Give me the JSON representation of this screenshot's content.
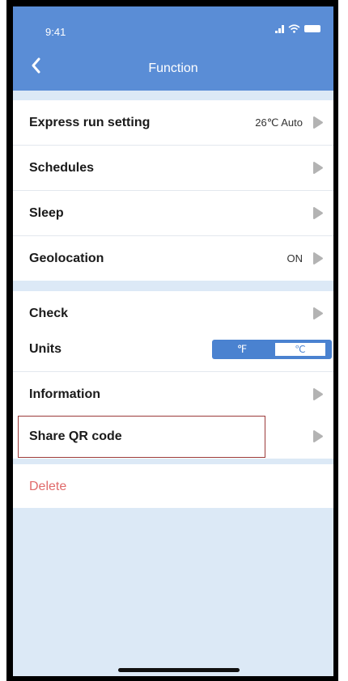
{
  "status_bar": {
    "time": "9:41",
    "signal_icon": "signal-icon",
    "wifi_icon": "wifi-icon",
    "battery_icon": "battery-icon"
  },
  "header": {
    "title": "Function",
    "back_icon": "chevron-left-icon",
    "background_color": "#5a8dd6"
  },
  "settings": {
    "express_run": {
      "label": "Express run setting",
      "value": "26℃ Auto"
    },
    "schedules": {
      "label": "Schedules"
    },
    "sleep": {
      "label": "Sleep"
    },
    "geolocation": {
      "label": "Geolocation",
      "value": "ON"
    },
    "check": {
      "label": "Check"
    },
    "units": {
      "label": "Units",
      "options": [
        "℉",
        "℃"
      ],
      "selected": "℃"
    },
    "information": {
      "label": "Information"
    },
    "share_qr": {
      "label": "Share QR code"
    },
    "delete": {
      "label": "Delete",
      "color": "#e06a6a"
    }
  },
  "colors": {
    "accent": "#5a8dd6",
    "page_background": "#dce9f6",
    "highlight_border": "#9b3a3a",
    "arrow": "#b3b3b3"
  }
}
